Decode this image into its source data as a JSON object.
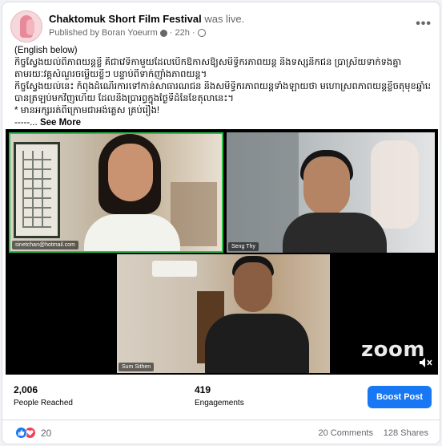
{
  "post": {
    "page_name": "Chaktomuk Short Film Festival",
    "live_suffix": "was live.",
    "published_by": "Published by Boran Yoeurm",
    "time": "· 22h ·",
    "more_icon": "more-horizontal-icon"
  },
  "body": {
    "lines": [
      "(English below)",
      "កិច្ចស្វែងយល់ពីភាពយន្តខ្លី គឺជាវេទិកាមួយដែលបើកឱកាសឱ្យសមិទ្ធិករភាពយន្ត និងទស្សនិកជន ប្រាស្រ័យទាក់ទងគ្នា",
      "តាមរយៈវគ្គសំណួរចម្លើយខ្លីៗ បន្ទាប់ពីទាក់ញាំងភាពយន្ត។",
      "កិច្ចស្វែងយល់នេះ កំពុងដំណើរការទៅកាន់សាធារណជន និងសមិទ្ធិករភាពយន្តទាំងឡាយថា មហោស្រពភាពយន្តខ្លីចតុមុខឆ្នាំនេះ",
      "បានត្រឡប់មកវិញហើយ ដែលនឹងប្រារព្ធក្នុងថ្ងៃទីដំនៃខែតុលានេះ។",
      "* មានអក្សររត់ពីក្រោមជាអង់គ្លេស គ្រប់រឿង!"
    ],
    "truncation": "-----...",
    "see_more": "See More"
  },
  "video": {
    "participants": [
      {
        "label": "sinetchan@hotmail.com",
        "active": true
      },
      {
        "label": "Seng Thy",
        "active": false
      },
      {
        "label": "Sum Sithen",
        "active": false
      }
    ],
    "watermark": "zoom",
    "mute_icon": "speaker-muted-icon"
  },
  "stats": {
    "reached_value": "2,006",
    "reached_label": "People Reached",
    "engagements_value": "419",
    "engagements_label": "Engagements",
    "boost_label": "Boost Post"
  },
  "footer": {
    "reaction_count": "20",
    "comments": "20 Comments",
    "shares": "128 Shares"
  },
  "colors": {
    "accent": "#1877f2",
    "active_speaker": "#24c64a",
    "love": "#f33e58"
  }
}
